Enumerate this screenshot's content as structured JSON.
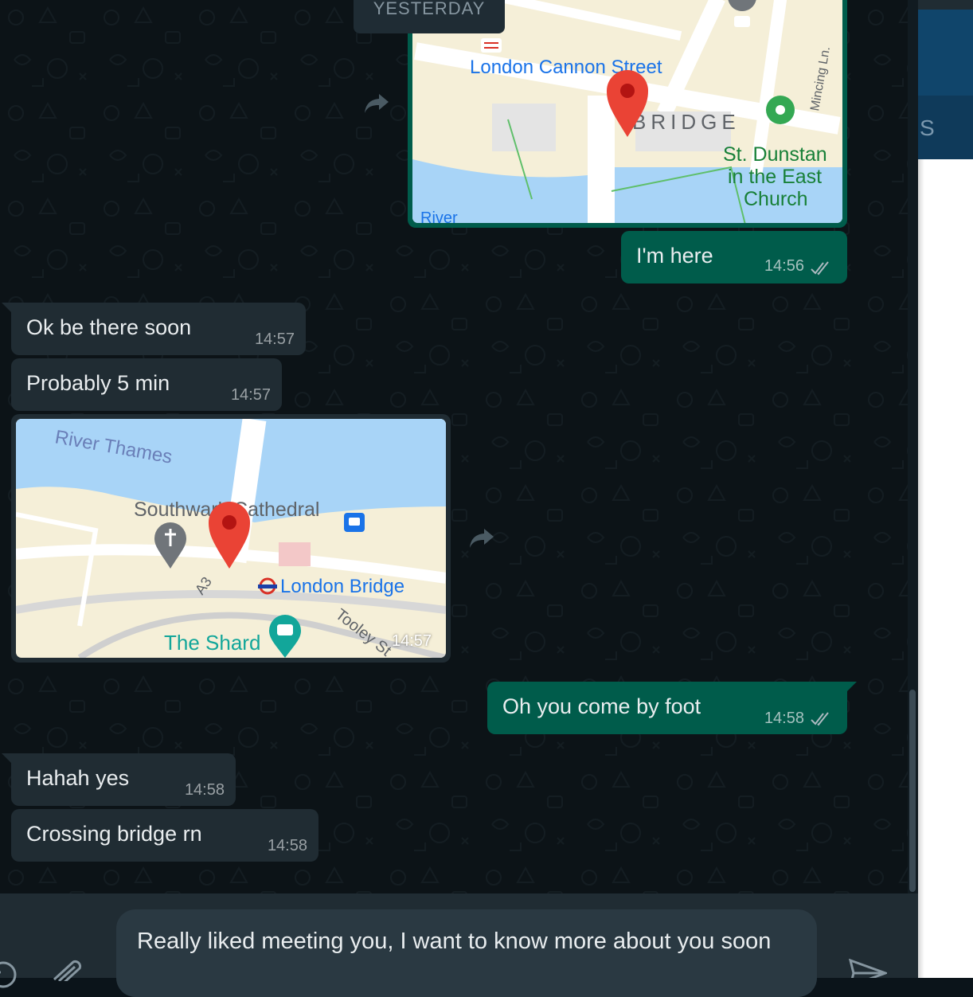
{
  "date_divider": "YESTERDAY",
  "messages": [
    {
      "type": "location",
      "direction": "out",
      "map_labels": [
        "London Cannon Street",
        "BRIDGE",
        "St. Dunstan",
        "in the East",
        "Church",
        "Mincing Ln.",
        "River"
      ]
    },
    {
      "type": "text",
      "direction": "out",
      "text": "I'm here",
      "time": "14:56",
      "status": "read"
    },
    {
      "type": "text",
      "direction": "in",
      "text": "Ok be there soon",
      "time": "14:57"
    },
    {
      "type": "text",
      "direction": "in",
      "text": "Probably 5 min",
      "time": "14:57"
    },
    {
      "type": "location",
      "direction": "in",
      "time": "14:57",
      "map_labels": [
        "River Thames",
        "Southwark Cathedral",
        "London Bridge",
        "The Shard",
        "Tooley St",
        "A3"
      ]
    },
    {
      "type": "text",
      "direction": "out",
      "text": "Oh you come by foot",
      "time": "14:58",
      "status": "read"
    },
    {
      "type": "text",
      "direction": "in",
      "text": "Hahah yes",
      "time": "14:58"
    },
    {
      "type": "text",
      "direction": "in",
      "text": "Crossing bridge rn",
      "time": "14:58"
    }
  ],
  "composer": {
    "draft": "Really liked meeting you, I want to know more about you soon",
    "icons": [
      "emoji-icon",
      "attach-icon",
      "send-icon"
    ]
  },
  "colors": {
    "incoming": "#202c33",
    "outgoing": "#005c4b",
    "background": "#0c1317",
    "accent": "#00a884"
  },
  "right_panel": {
    "letter": "S"
  }
}
